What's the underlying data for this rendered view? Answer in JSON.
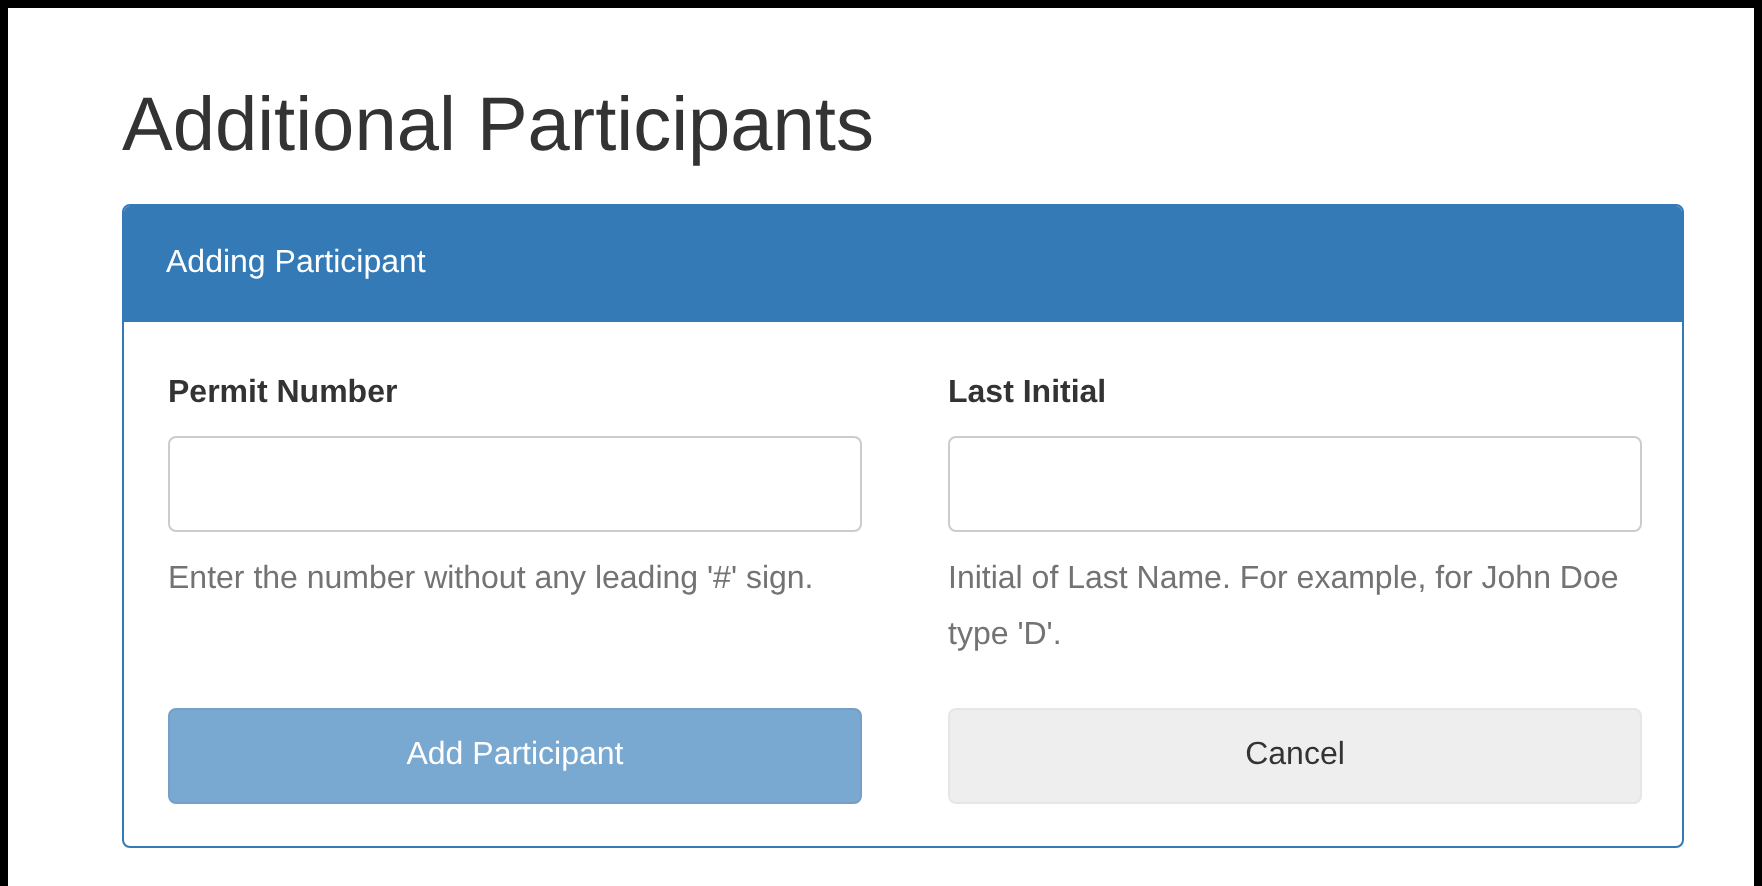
{
  "page": {
    "title": "Additional Participants"
  },
  "panel": {
    "title": "Adding Participant",
    "fields": [
      {
        "label": "Permit Number",
        "help": "Enter the number without any leading '#' sign."
      },
      {
        "label": "Last Initial",
        "help": "Initial of Last Name. For example, for John Doe type 'D'."
      }
    ],
    "buttons": [
      {
        "label": "Add Participant",
        "kind": "primary",
        "disabled": true
      },
      {
        "label": "Cancel",
        "kind": "default",
        "disabled": false
      }
    ]
  }
}
